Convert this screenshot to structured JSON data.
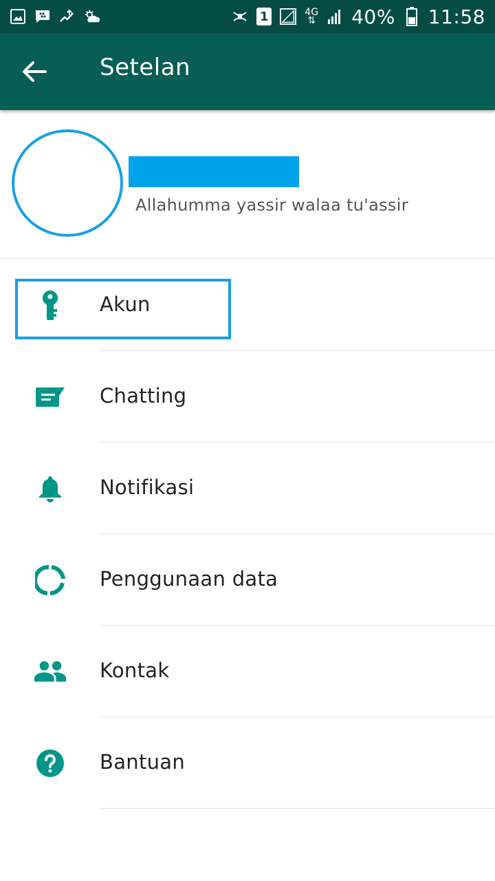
{
  "status_bar": {
    "battery": "40%",
    "time": "11:58",
    "sim_slot": "1",
    "network": "4G"
  },
  "app_bar": {
    "title": "Setelan"
  },
  "profile": {
    "status": "Allahumma yassir walaa tu'assir"
  },
  "menu": {
    "items": [
      {
        "label": "Akun",
        "icon": "key-icon"
      },
      {
        "label": "Chatting",
        "icon": "chat-icon"
      },
      {
        "label": "Notifikasi",
        "icon": "bell-icon"
      },
      {
        "label": "Penggunaan data",
        "icon": "data-usage-icon"
      },
      {
        "label": "Kontak",
        "icon": "contacts-icon"
      },
      {
        "label": "Bantuan",
        "icon": "help-icon"
      }
    ]
  },
  "colors": {
    "status_bar": "#054d44",
    "app_bar": "#075e54",
    "accent": "#009688",
    "highlight": "#1a9fe3",
    "redaction": "#02a2ea"
  }
}
